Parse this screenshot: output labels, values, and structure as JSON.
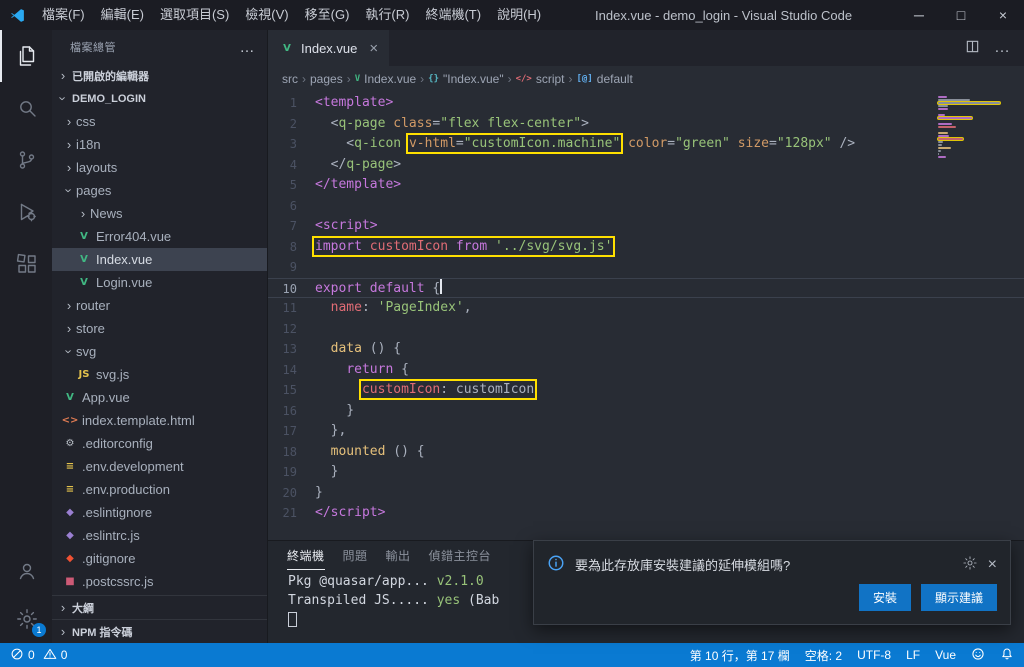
{
  "titlebar": {
    "menus": [
      {
        "label": "檔案(F)",
        "name": "menu-file"
      },
      {
        "label": "編輯(E)",
        "name": "menu-edit"
      },
      {
        "label": "選取項目(S)",
        "name": "menu-selection"
      },
      {
        "label": "檢視(V)",
        "name": "menu-view"
      },
      {
        "label": "移至(G)",
        "name": "menu-go"
      },
      {
        "label": "執行(R)",
        "name": "menu-run"
      },
      {
        "label": "終端機(T)",
        "name": "menu-terminal"
      },
      {
        "label": "說明(H)",
        "name": "menu-help"
      }
    ],
    "title": "Index.vue - demo_login - Visual Studio Code",
    "window_controls": {
      "minimize": "─",
      "maximize": "□",
      "close": "×"
    }
  },
  "activitybar": {
    "top": [
      {
        "name": "explorer",
        "active": true
      },
      {
        "name": "search"
      },
      {
        "name": "source-control"
      },
      {
        "name": "run-debug"
      },
      {
        "name": "extensions"
      }
    ],
    "bottom": [
      {
        "name": "account"
      },
      {
        "name": "settings",
        "badge": "1"
      }
    ]
  },
  "sidebar": {
    "title": "檔案總管",
    "open_editors_label": "已開啟的編輯器",
    "root_label": "DEMO_LOGIN",
    "outline_label": "大綱",
    "npm_label": "NPM 指令碼",
    "tree": [
      {
        "label": "css",
        "type": "folder",
        "indent": 1,
        "expanded": false
      },
      {
        "label": "i18n",
        "type": "folder",
        "indent": 1,
        "expanded": false
      },
      {
        "label": "layouts",
        "type": "folder",
        "indent": 1,
        "expanded": false
      },
      {
        "label": "pages",
        "type": "folder",
        "indent": 1,
        "expanded": true
      },
      {
        "label": "News",
        "type": "folder",
        "indent": 2,
        "expanded": false
      },
      {
        "label": "Error404.vue",
        "type": "vue",
        "indent": 2
      },
      {
        "label": "Index.vue",
        "type": "vue",
        "indent": 2,
        "selected": true
      },
      {
        "label": "Login.vue",
        "type": "vue",
        "indent": 2
      },
      {
        "label": "router",
        "type": "folder",
        "indent": 1,
        "expanded": false
      },
      {
        "label": "store",
        "type": "folder",
        "indent": 1,
        "expanded": false
      },
      {
        "label": "svg",
        "type": "folder",
        "indent": 1,
        "expanded": true
      },
      {
        "label": "svg.js",
        "type": "js",
        "indent": 2
      },
      {
        "label": "App.vue",
        "type": "vue",
        "indent": 1
      },
      {
        "label": "index.template.html",
        "type": "html",
        "indent": 1
      },
      {
        "label": ".editorconfig",
        "type": "editorconfig",
        "indent": 1
      },
      {
        "label": ".env.development",
        "type": "env",
        "indent": 1
      },
      {
        "label": ".env.production",
        "type": "env",
        "indent": 1
      },
      {
        "label": ".eslintignore",
        "type": "eslint",
        "indent": 1
      },
      {
        "label": ".eslintrc.js",
        "type": "eslint",
        "indent": 1
      },
      {
        "label": ".gitignore",
        "type": "git",
        "indent": 1
      },
      {
        "label": ".postcssrc.js",
        "type": "postcss",
        "indent": 1
      }
    ]
  },
  "editor": {
    "tab_label": "Index.vue",
    "breadcrumb": [
      {
        "label": "src",
        "name": "breadcrumb-src"
      },
      {
        "label": "pages",
        "name": "breadcrumb-pages"
      },
      {
        "label": "Index.vue",
        "name": "breadcrumb-index-vue",
        "icon": "vue"
      },
      {
        "label": "\"Index.vue\"",
        "name": "breadcrumb-index-vue-root",
        "icon": "braces"
      },
      {
        "label": "script",
        "name": "breadcrumb-script",
        "icon": "markup"
      },
      {
        "label": "default",
        "name": "breadcrumb-default",
        "icon": "symbol"
      }
    ],
    "code": {
      "lines": [
        {
          "n": 1,
          "segs": [
            {
              "t": "<template>",
              "c": "tag"
            }
          ]
        },
        {
          "n": 2,
          "segs": [
            {
              "t": "  <",
              "c": "pun"
            },
            {
              "t": "q-page",
              "c": "comp"
            },
            {
              "t": " ",
              "c": "fg"
            },
            {
              "t": "class",
              "c": "attr"
            },
            {
              "t": "=",
              "c": "pun"
            },
            {
              "t": "\"flex flex-center\"",
              "c": "str"
            },
            {
              "t": ">",
              "c": "pun"
            }
          ]
        },
        {
          "n": 3,
          "segs": [
            {
              "t": "    <",
              "c": "pun"
            },
            {
              "t": "q-icon",
              "c": "comp"
            },
            {
              "t": " ",
              "c": "fg"
            },
            {
              "t": "v-html",
              "c": "attr",
              "bx": true
            },
            {
              "t": "=",
              "c": "pun",
              "bx": true
            },
            {
              "t": "\"customIcon.machine\"",
              "c": "str",
              "bx": true
            },
            {
              "t": " ",
              "c": "fg"
            },
            {
              "t": "color",
              "c": "attr"
            },
            {
              "t": "=",
              "c": "pun"
            },
            {
              "t": "\"green\"",
              "c": "str"
            },
            {
              "t": " ",
              "c": "fg"
            },
            {
              "t": "size",
              "c": "attr"
            },
            {
              "t": "=",
              "c": "pun"
            },
            {
              "t": "\"128px\"",
              "c": "str"
            },
            {
              "t": " />",
              "c": "pun"
            }
          ]
        },
        {
          "n": 4,
          "segs": [
            {
              "t": "  </",
              "c": "pun"
            },
            {
              "t": "q-page",
              "c": "comp"
            },
            {
              "t": ">",
              "c": "pun"
            }
          ]
        },
        {
          "n": 5,
          "segs": [
            {
              "t": "</template>",
              "c": "tag"
            }
          ]
        },
        {
          "n": 6,
          "segs": []
        },
        {
          "n": 7,
          "segs": [
            {
              "t": "<script>",
              "c": "tag"
            }
          ]
        },
        {
          "n": 8,
          "segs": [
            {
              "t": "import",
              "c": "kw",
              "bx": true
            },
            {
              "t": " ",
              "c": "fg",
              "bx": true
            },
            {
              "t": "customIcon",
              "c": "id",
              "bx": true
            },
            {
              "t": " ",
              "c": "fg",
              "bx": true
            },
            {
              "t": "from",
              "c": "kw",
              "bx": true
            },
            {
              "t": " ",
              "c": "fg",
              "bx": true
            },
            {
              "t": "'../svg/svg.js'",
              "c": "str",
              "bx": true
            }
          ]
        },
        {
          "n": 9,
          "segs": []
        },
        {
          "n": 10,
          "current": true,
          "cursor": true,
          "segs": [
            {
              "t": "export",
              "c": "kw"
            },
            {
              "t": " ",
              "c": "fg"
            },
            {
              "t": "default",
              "c": "kw"
            },
            {
              "t": " ",
              "c": "fg"
            },
            {
              "t": "{",
              "c": "pun"
            }
          ]
        },
        {
          "n": 11,
          "segs": [
            {
              "t": "  ",
              "c": "fg"
            },
            {
              "t": "name",
              "c": "prop"
            },
            {
              "t": ": ",
              "c": "pun"
            },
            {
              "t": "'PageIndex'",
              "c": "str"
            },
            {
              "t": ",",
              "c": "pun"
            }
          ]
        },
        {
          "n": 12,
          "segs": []
        },
        {
          "n": 13,
          "segs": [
            {
              "t": "  ",
              "c": "fg"
            },
            {
              "t": "data",
              "c": "fn"
            },
            {
              "t": " () {",
              "c": "pun"
            }
          ]
        },
        {
          "n": 14,
          "segs": [
            {
              "t": "    ",
              "c": "fg"
            },
            {
              "t": "return",
              "c": "kw"
            },
            {
              "t": " {",
              "c": "pun"
            }
          ]
        },
        {
          "n": 15,
          "segs": [
            {
              "t": "      ",
              "c": "fg"
            },
            {
              "t": "customIcon",
              "c": "prop",
              "bx": true
            },
            {
              "t": ": ",
              "c": "pun",
              "bx": true
            },
            {
              "t": "customIcon",
              "c": "fg",
              "bx": true
            }
          ]
        },
        {
          "n": 16,
          "segs": [
            {
              "t": "    }",
              "c": "pun"
            }
          ]
        },
        {
          "n": 17,
          "segs": [
            {
              "t": "  },",
              "c": "pun"
            }
          ]
        },
        {
          "n": 18,
          "segs": [
            {
              "t": "  ",
              "c": "fg"
            },
            {
              "t": "mounted",
              "c": "fn"
            },
            {
              "t": " () {",
              "c": "pun"
            }
          ]
        },
        {
          "n": 19,
          "segs": [
            {
              "t": "  }",
              "c": "pun"
            }
          ]
        },
        {
          "n": 20,
          "segs": [
            {
              "t": "}",
              "c": "pun"
            }
          ]
        },
        {
          "n": 21,
          "segs": [
            {
              "t": "</script>",
              "c": "tag"
            }
          ]
        }
      ]
    }
  },
  "panel": {
    "tabs": [
      {
        "label": "終端機",
        "name": "terminal",
        "active": true
      },
      {
        "label": "問題",
        "name": "problems"
      },
      {
        "label": "輸出",
        "name": "output"
      },
      {
        "label": "偵錯主控台",
        "name": "debug-console"
      }
    ],
    "terminal": {
      "lines": [
        [
          {
            "t": "Pkg @quasar/app... ",
            "c": "fg"
          },
          {
            "t": "v2.1.0",
            "c": "green"
          }
        ],
        [
          {
            "t": "Transpiled JS..... ",
            "c": "fg"
          },
          {
            "t": "yes",
            "c": "green"
          },
          {
            "t": " (Bab",
            "c": "fg"
          }
        ]
      ]
    }
  },
  "notification": {
    "message": "要為此存放庫安裝建議的延伸模組嗎?",
    "buttons": [
      {
        "label": "安裝",
        "name": "install-button"
      },
      {
        "label": "顯示建議",
        "name": "show-recommendations-button"
      }
    ]
  },
  "statusbar": {
    "left": [
      {
        "name": "problems-errors",
        "icon": "error",
        "text": "0"
      },
      {
        "name": "problems-warnings",
        "icon": "warning",
        "text": "0"
      }
    ],
    "right": [
      {
        "name": "cursor-position",
        "text": "第 10 行，第 17 欄"
      },
      {
        "name": "indentation",
        "text": "空格: 2"
      },
      {
        "name": "encoding",
        "text": "UTF-8"
      },
      {
        "name": "eol",
        "text": "LF"
      },
      {
        "name": "language-mode",
        "text": "Vue"
      },
      {
        "name": "feedback",
        "icon": "feedback"
      },
      {
        "name": "notifications",
        "icon": "bell"
      }
    ]
  },
  "colors": {
    "accent": "#0a7ad2",
    "highlight_box": "#ffe000",
    "vue_green": "#41b883",
    "statusbar_bg": "#0a7ad2"
  }
}
